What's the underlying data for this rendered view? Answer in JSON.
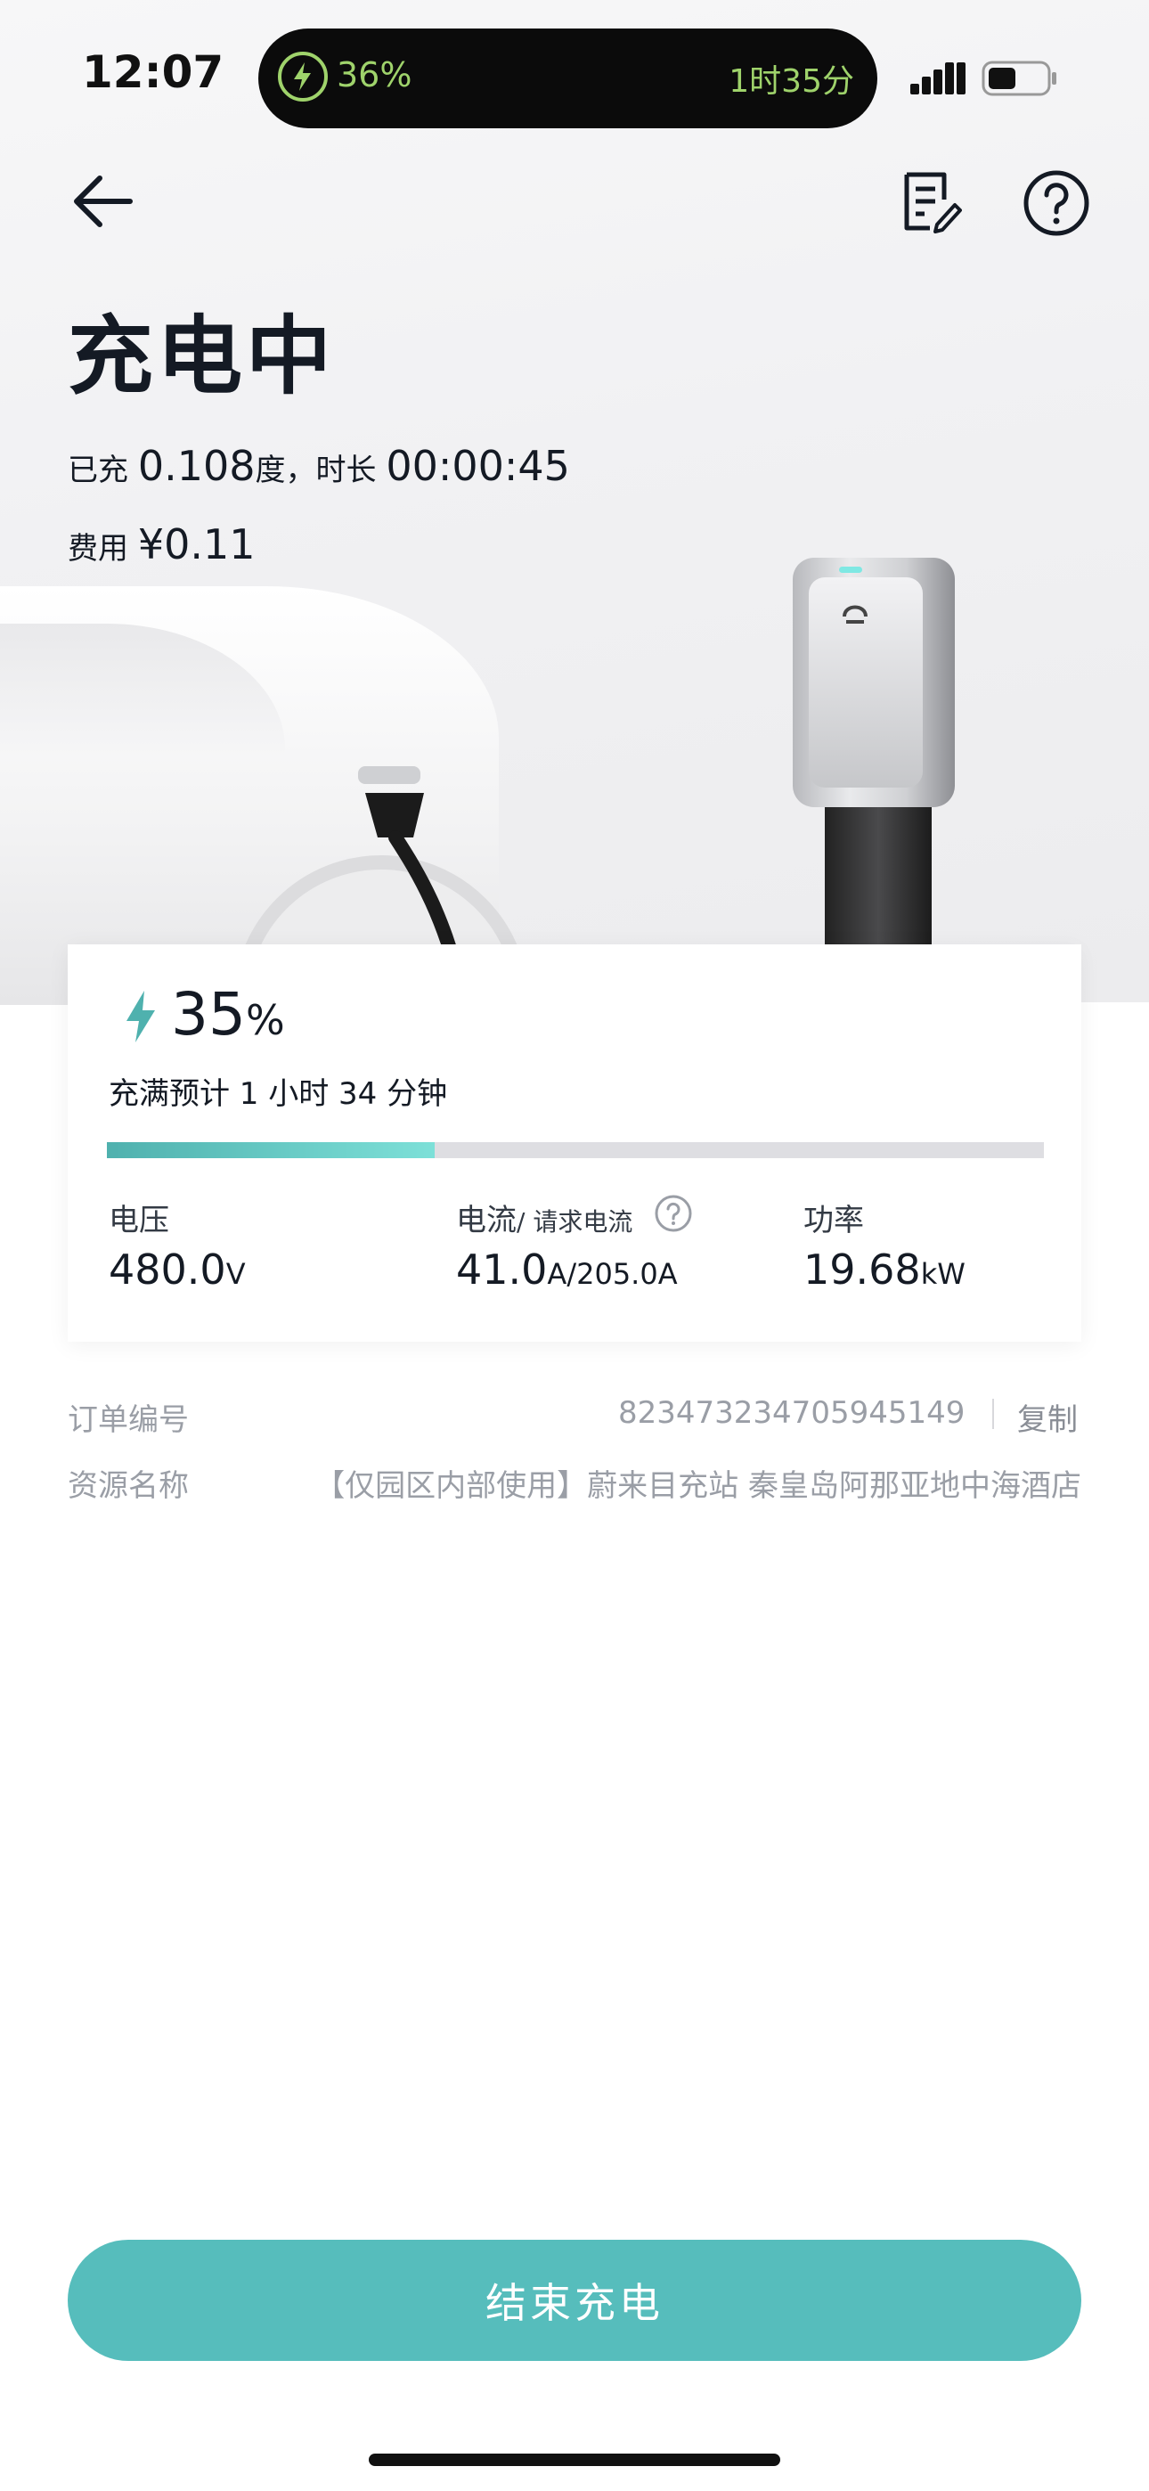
{
  "status_bar": {
    "time": "12:07",
    "activity_percent": "36%",
    "activity_eta": "1时35分",
    "icons": [
      "lightning-icon",
      "signal-icon",
      "battery-icon"
    ]
  },
  "nav": {
    "back_icon": "arrow-left-icon",
    "record_icon": "edit-document-icon",
    "help_icon": "question-circle-icon"
  },
  "header": {
    "title": "充电中",
    "charged_label": "已充",
    "charged_value": "0.108",
    "charged_unit": "度，",
    "duration_label": "时长",
    "duration_value": "00:00:45",
    "fee_label": "费用",
    "fee_value": "¥0.11"
  },
  "card": {
    "battery_percent": "35",
    "percent_sign": "%",
    "battery_fraction": 0.35,
    "eta_text": "充满预计 1 小时 34 分钟",
    "voltage_label": "电压",
    "voltage_value": "480.0",
    "voltage_unit": "V",
    "current_label": "电流",
    "current_sublabel": "/ 请求电流",
    "current_value": "41.0",
    "current_unit": "A",
    "requested_current": "/205.0A",
    "power_label": "功率",
    "power_value": "19.68",
    "power_unit": "kW"
  },
  "order": {
    "number_label": "订单编号",
    "number_value": "823473234705945149",
    "copy_label": "复制",
    "resource_label": "资源名称",
    "resource_value": "【仅园区内部使用】蔚来目充站 秦皇岛阿那亚地中海酒店"
  },
  "footer": {
    "end_button": "结束充电"
  },
  "colors": {
    "accent": "#56bdbc",
    "progress_start": "#4fb1ae",
    "progress_end": "#7de0d8",
    "island_text": "#9fd36b"
  }
}
